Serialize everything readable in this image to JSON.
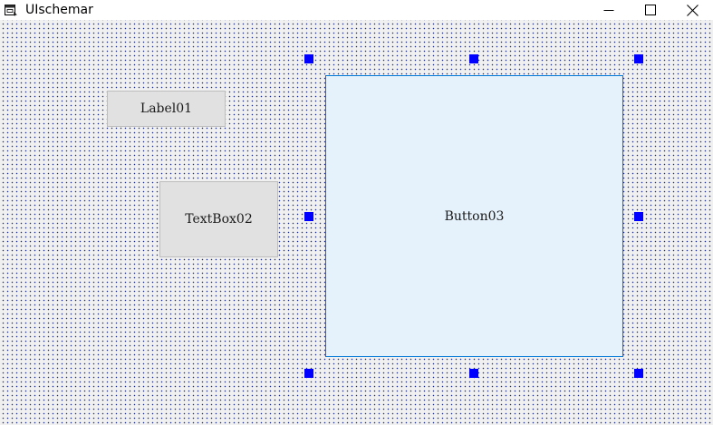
{
  "window": {
    "title": "UIschemar",
    "icon": "window-form-icon",
    "controls": {
      "minimize_icon": "minimize-icon",
      "maximize_icon": "maximize-icon",
      "close_icon": "close-icon"
    }
  },
  "designer": {
    "grid_dot_color": "#1a2a8a",
    "background_color": "#f0f0f0",
    "selection_handle_color": "#0000ff",
    "controls": [
      {
        "name": "Label01",
        "text": "Label01",
        "type": "label",
        "selected": false
      },
      {
        "name": "TextBox02",
        "text": "TextBox02",
        "type": "textbox",
        "selected": false
      },
      {
        "name": "Button03",
        "text": "Button03",
        "type": "button",
        "selected": true
      }
    ]
  }
}
